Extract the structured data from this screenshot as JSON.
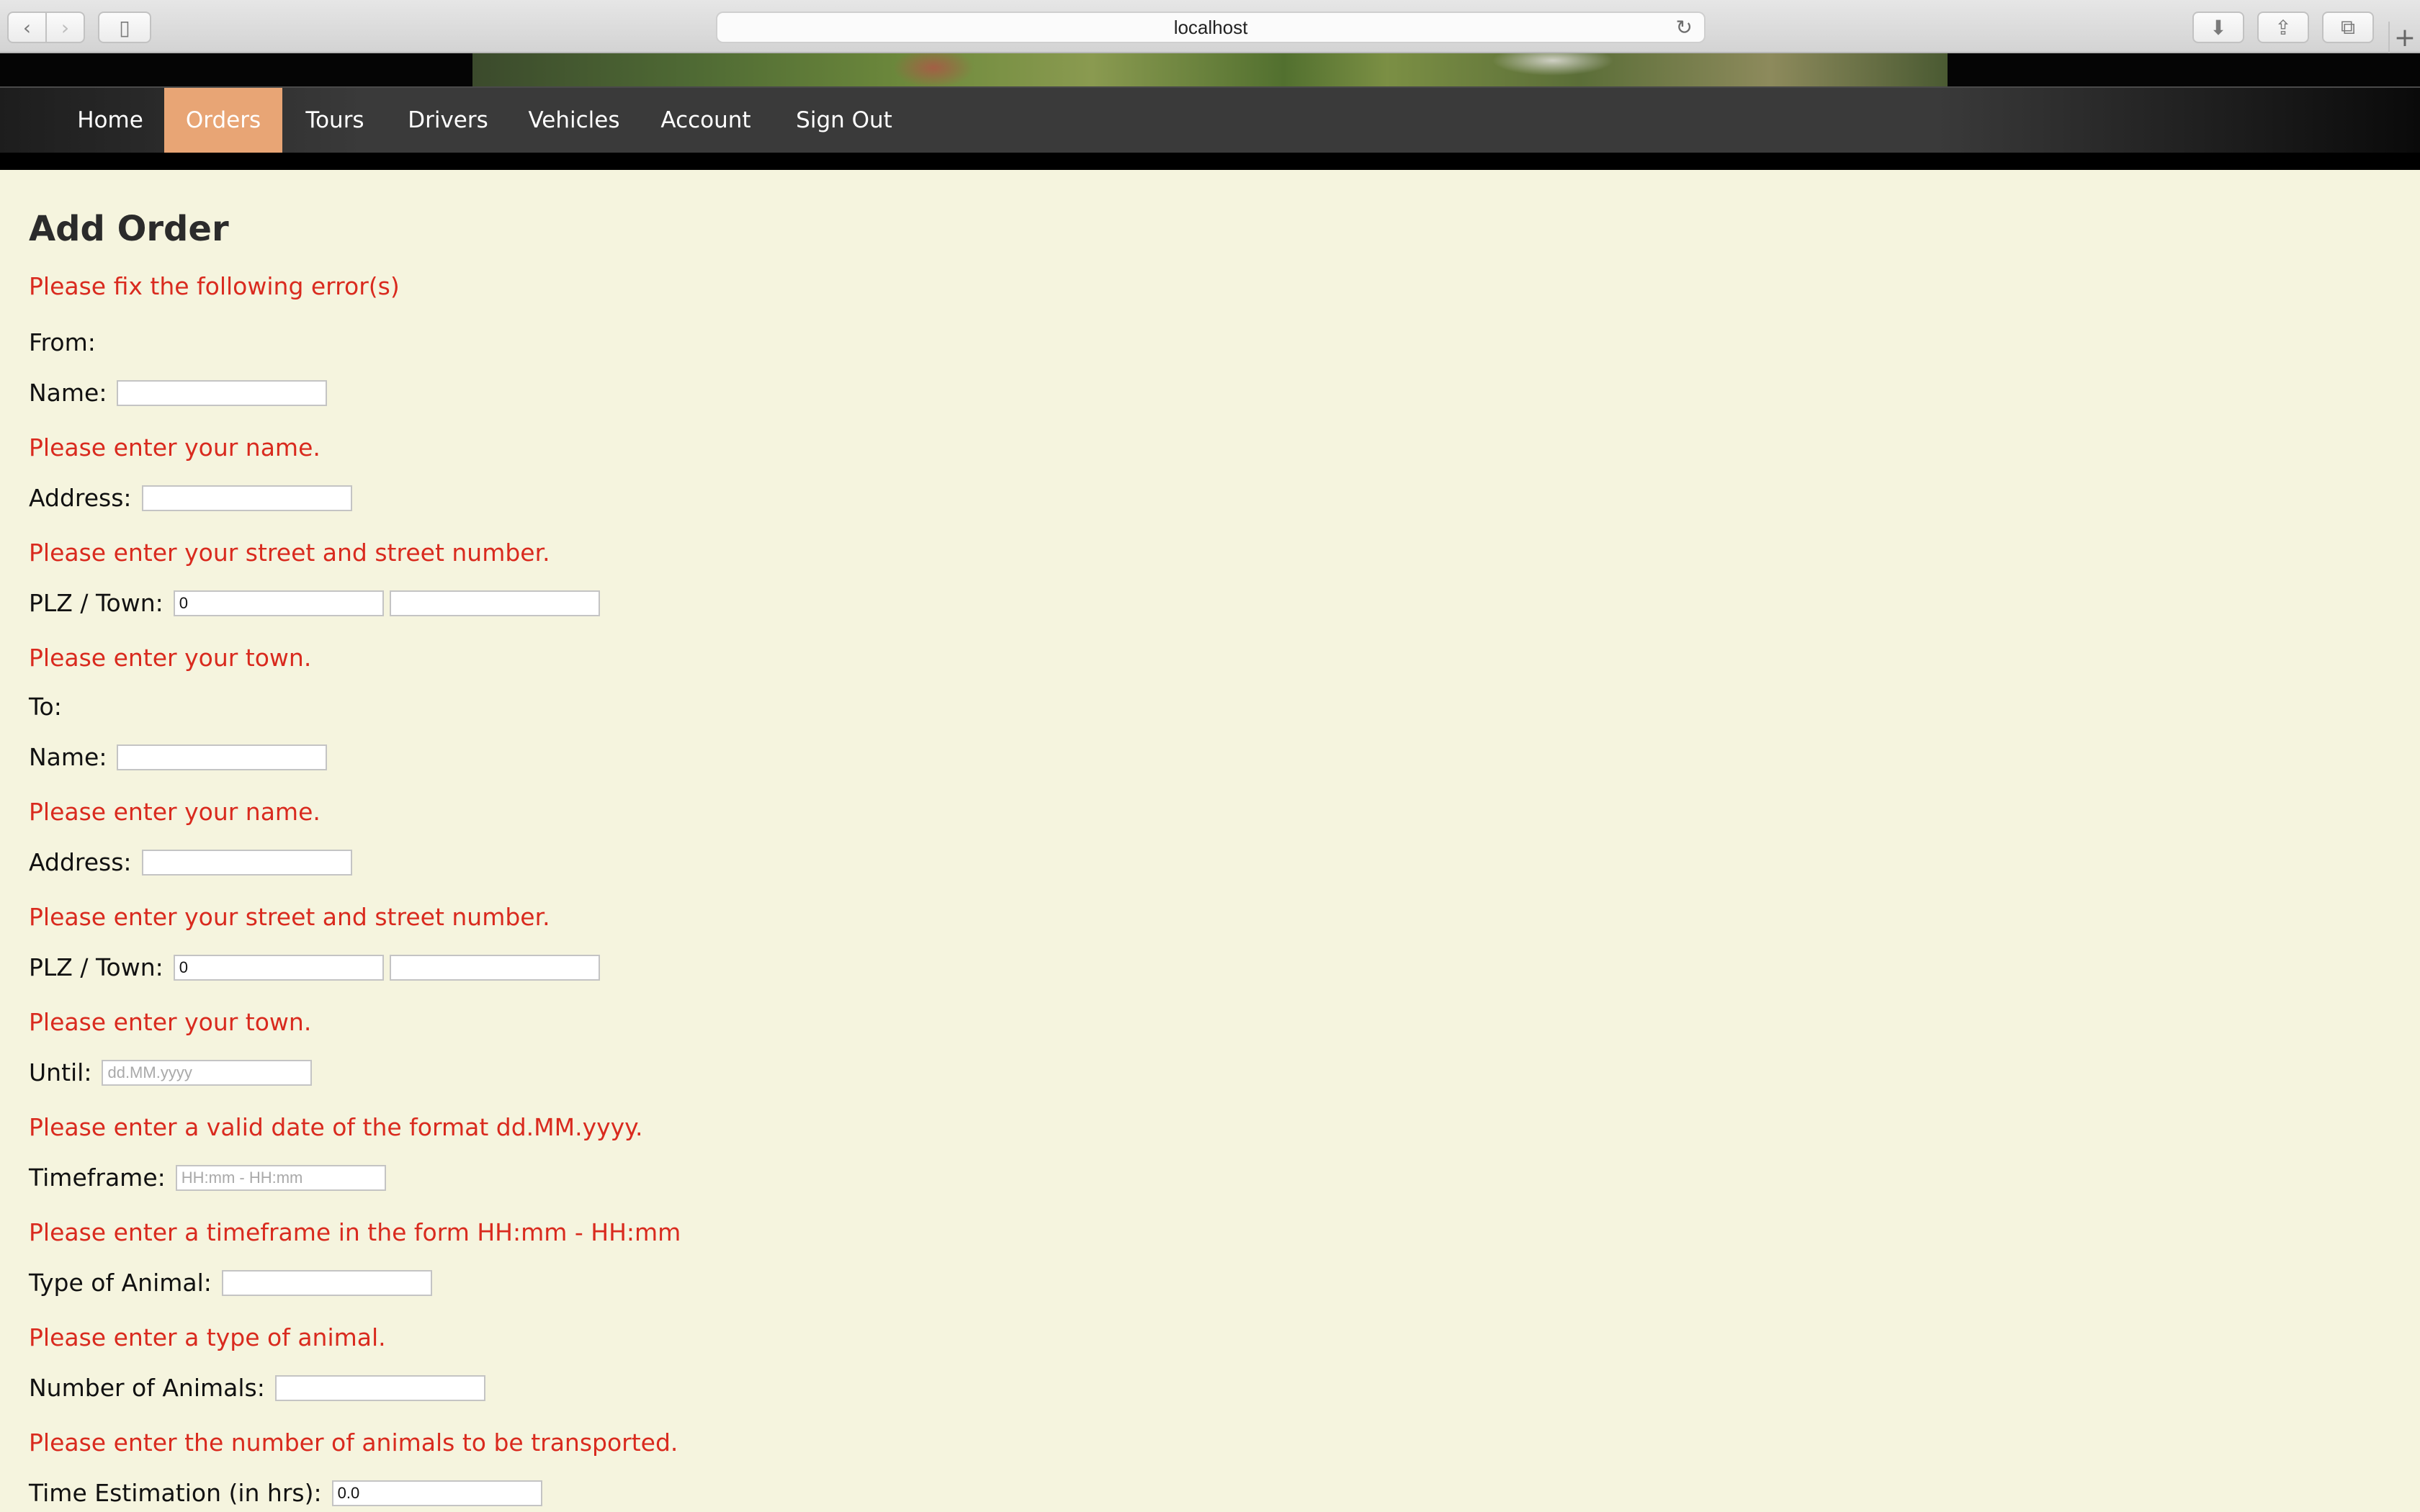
{
  "browser": {
    "url": "localhost"
  },
  "nav": {
    "items": [
      "Home",
      "Orders",
      "Tours",
      "Drivers",
      "Vehicles",
      "Account",
      "Sign Out"
    ],
    "active": "Orders",
    "active_color": "#e8a575"
  },
  "page": {
    "title": "Add Order",
    "error_summary": "Please fix the following error(s)",
    "error_color": "#d92a1e"
  },
  "from": {
    "heading": "From:",
    "name_label": "Name:",
    "name_value": "",
    "name_error": "Please enter your name.",
    "address_label": "Address:",
    "address_value": "",
    "address_error": "Please enter your street and street number.",
    "plz_label": "PLZ / Town:",
    "plz_value": "0",
    "town_value": "",
    "town_error": "Please enter your town."
  },
  "to": {
    "heading": "To:",
    "name_label": "Name:",
    "name_value": "",
    "name_error": "Please enter your name.",
    "address_label": "Address:",
    "address_value": "",
    "address_error": "Please enter your street and street number.",
    "plz_label": "PLZ / Town:",
    "plz_value": "0",
    "town_value": "",
    "town_error": "Please enter your town."
  },
  "until": {
    "label": "Until:",
    "placeholder": "dd.MM.yyyy",
    "error": "Please enter a valid date of the format dd.MM.yyyy."
  },
  "timeframe": {
    "label": "Timeframe:",
    "placeholder": "HH:mm - HH:mm",
    "error": "Please enter a timeframe in the form HH:mm - HH:mm"
  },
  "animal_type": {
    "label": "Type of Animal:",
    "value": "",
    "error": "Please enter a type of animal."
  },
  "animal_count": {
    "label": "Number of Animals:",
    "value": "",
    "error": "Please enter the number of animals to be transported."
  },
  "time_estimation": {
    "label": "Time Estimation (in hrs):",
    "value": "0.0"
  }
}
